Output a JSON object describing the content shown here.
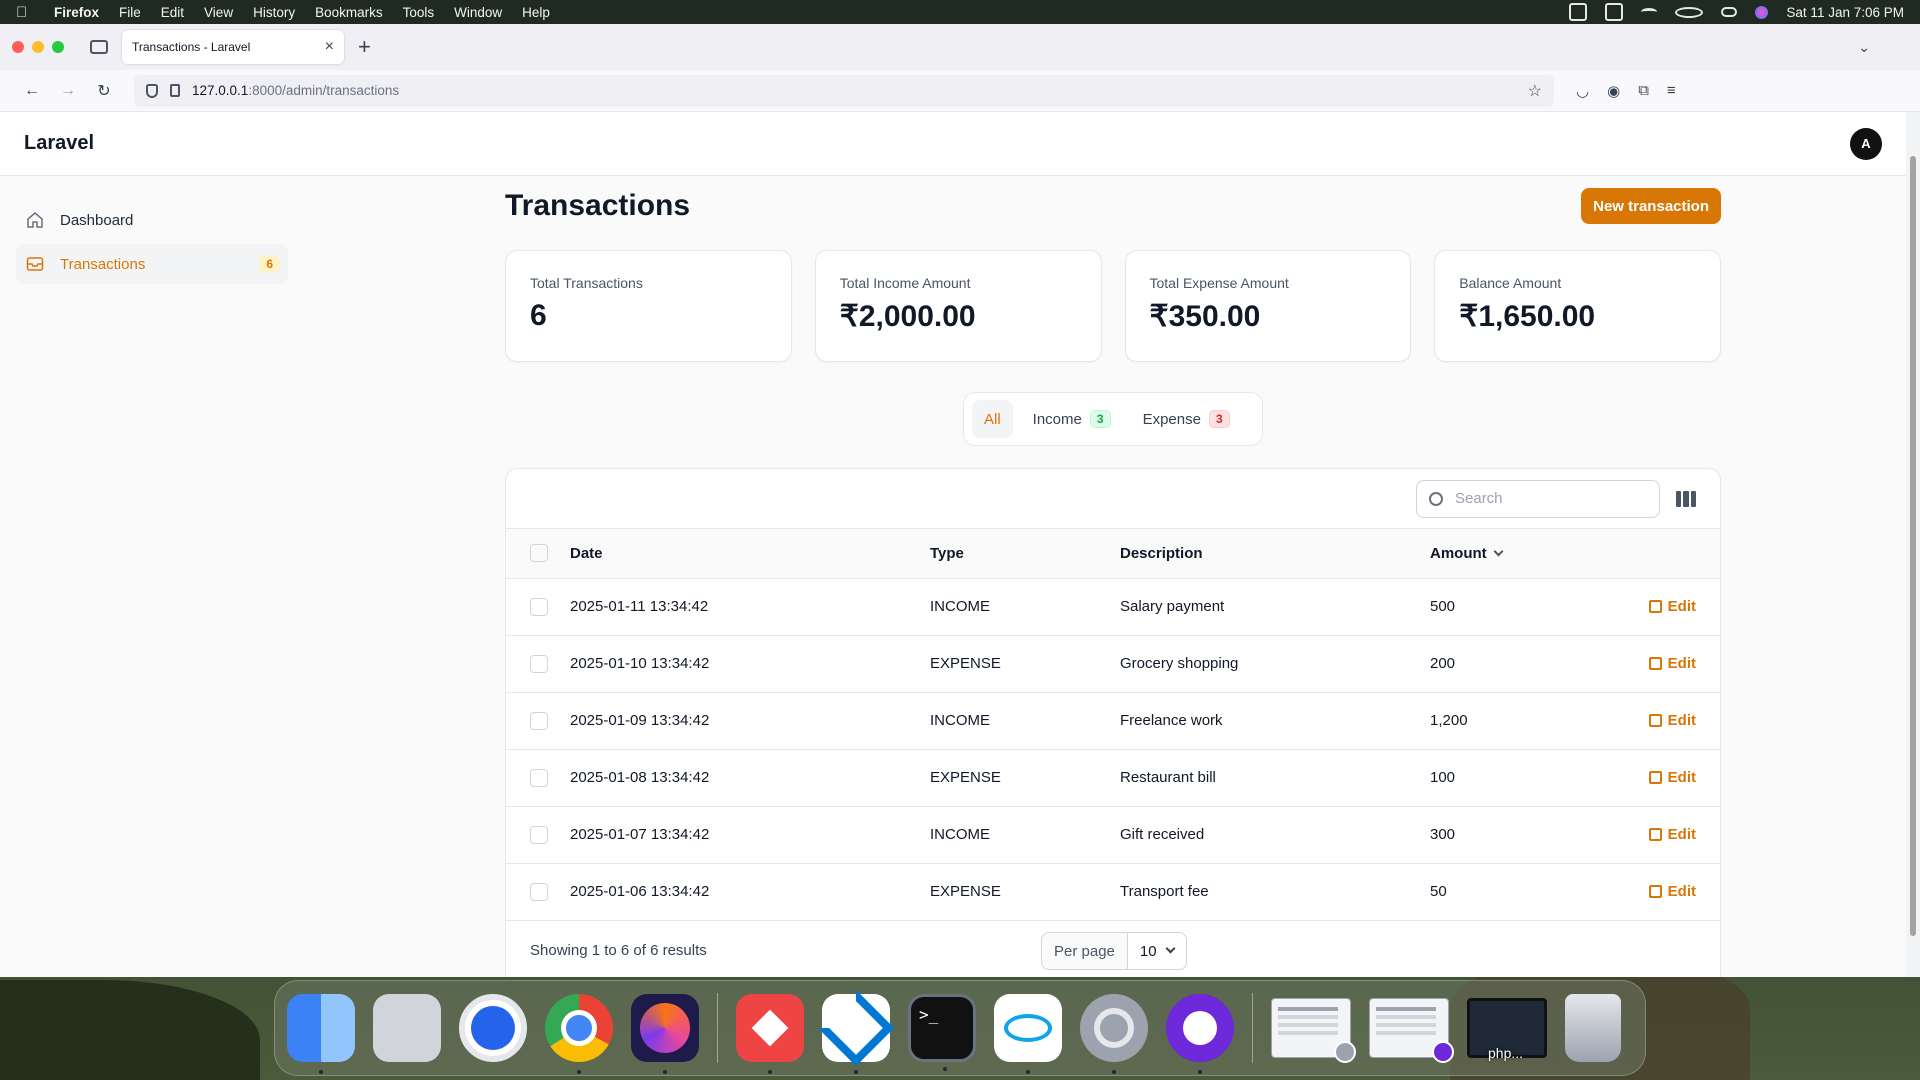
{
  "menubar": {
    "app": "Firefox",
    "items": [
      "File",
      "Edit",
      "View",
      "History",
      "Bookmarks",
      "Tools",
      "Window",
      "Help"
    ],
    "clock": "Sat 11 Jan  7:06 PM"
  },
  "browser": {
    "tab_title": "Transactions - Laravel",
    "url_host": "127.0.0.1",
    "url_path": ":8000/admin/transactions"
  },
  "app": {
    "brand": "Laravel",
    "avatar_initial": "A",
    "sidebar": {
      "items": [
        {
          "label": "Dashboard",
          "icon": "home-icon"
        },
        {
          "label": "Transactions",
          "icon": "inbox-icon",
          "badge": "6"
        }
      ]
    },
    "page_title": "Transactions",
    "new_button": "New transaction",
    "stats": [
      {
        "label": "Total Transactions",
        "value": "6"
      },
      {
        "label": "Total Income Amount",
        "value": "₹2,000.00"
      },
      {
        "label": "Total Expense Amount",
        "value": "₹350.00"
      },
      {
        "label": "Balance Amount",
        "value": "₹1,650.00"
      }
    ],
    "filters": [
      {
        "label": "All"
      },
      {
        "label": "Income",
        "count": "3"
      },
      {
        "label": "Expense",
        "count": "3"
      }
    ],
    "search_placeholder": "Search",
    "table": {
      "columns": [
        "Date",
        "Type",
        "Description",
        "Amount"
      ],
      "edit_label": "Edit",
      "rows": [
        {
          "date": "2025-01-11 13:34:42",
          "type": "INCOME",
          "description": "Salary payment",
          "amount": "500"
        },
        {
          "date": "2025-01-10 13:34:42",
          "type": "EXPENSE",
          "description": "Grocery shopping",
          "amount": "200"
        },
        {
          "date": "2025-01-09 13:34:42",
          "type": "INCOME",
          "description": "Freelance work",
          "amount": "1,200"
        },
        {
          "date": "2025-01-08 13:34:42",
          "type": "EXPENSE",
          "description": "Restaurant bill",
          "amount": "100"
        },
        {
          "date": "2025-01-07 13:34:42",
          "type": "INCOME",
          "description": "Gift received",
          "amount": "300"
        },
        {
          "date": "2025-01-06 13:34:42",
          "type": "EXPENSE",
          "description": "Transport fee",
          "amount": "50"
        }
      ]
    },
    "footer": {
      "showing": "Showing 1 to 6 of 6 results",
      "per_page_label": "Per page",
      "per_page_value": "10"
    }
  },
  "dock": {
    "terminal_prompt": ">_",
    "php_label": "php..."
  },
  "colors": {
    "accent": "#d97706",
    "income_badge": "#16a34a",
    "expense_badge": "#dc2626"
  }
}
